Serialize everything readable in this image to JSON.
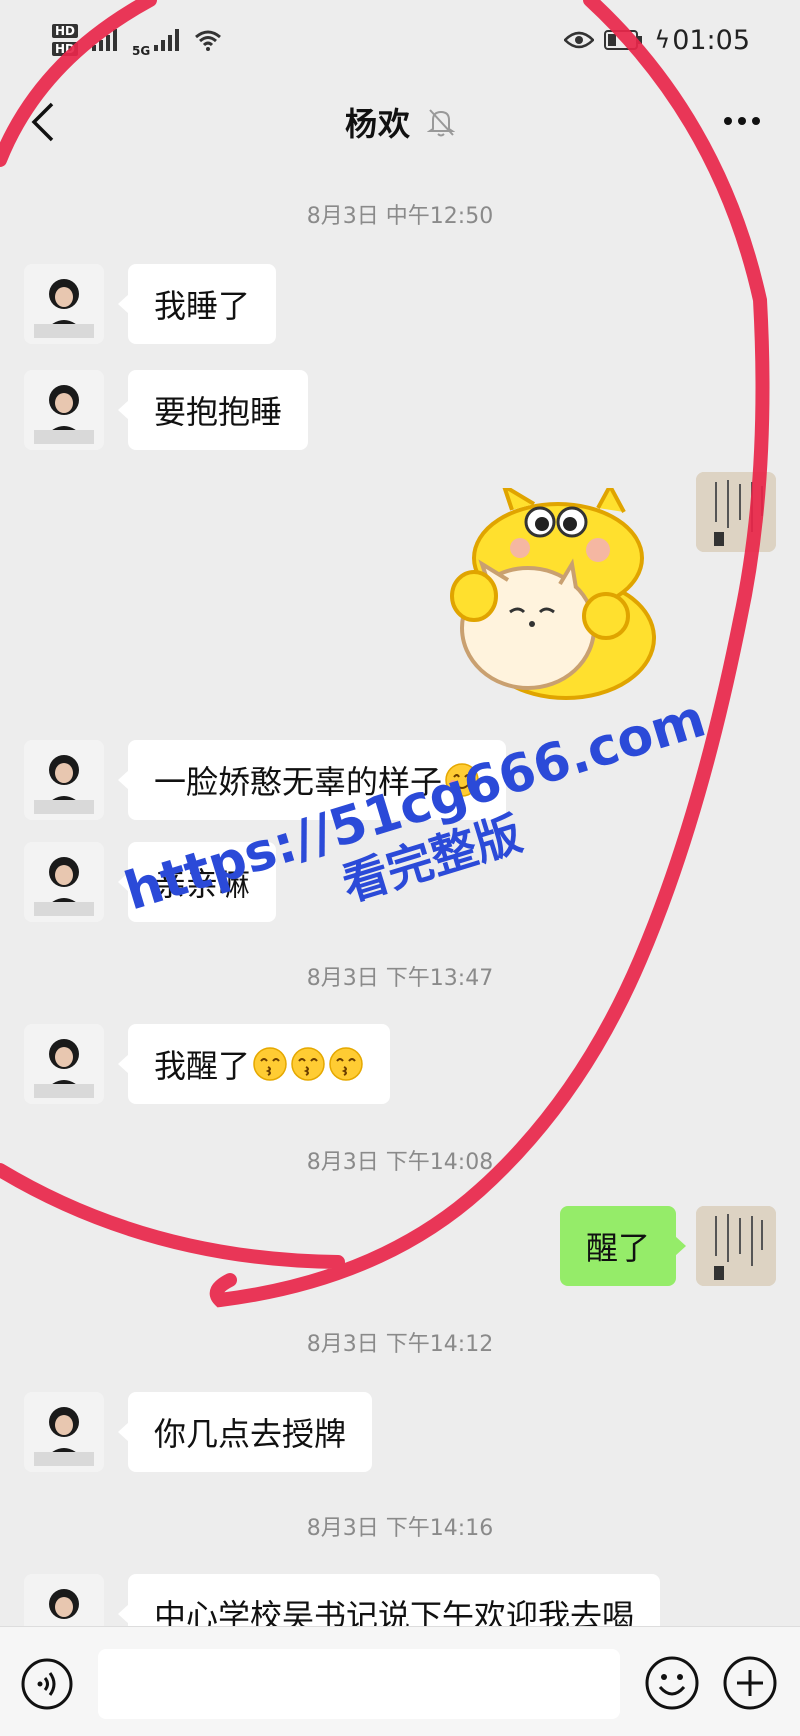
{
  "status_bar": {
    "hd_badge_top": "HD",
    "hd_badge_bottom": "HD",
    "network": "5G",
    "time": "01:05"
  },
  "nav": {
    "title": "杨欢"
  },
  "messages": [
    {
      "type": "timestamp",
      "text": "8月3日 中午12:50"
    },
    {
      "type": "received",
      "text": "我睡了"
    },
    {
      "type": "received",
      "text": "要抱抱睡"
    },
    {
      "type": "sent_sticker",
      "sticker": "yellow-cat-hugging-kitten-sticker"
    },
    {
      "type": "received",
      "text": "一脸娇憨无辜的样子"
    },
    {
      "type": "received",
      "text": "亲亲嘛"
    },
    {
      "type": "timestamp",
      "text": "8月3日 下午13:47"
    },
    {
      "type": "received",
      "text": "我醒了"
    },
    {
      "type": "timestamp",
      "text": "8月3日 下午14:08"
    },
    {
      "type": "sent",
      "text": "醒了"
    },
    {
      "type": "timestamp",
      "text": "8月3日 下午14:12"
    },
    {
      "type": "received",
      "text": "你几点去授牌"
    },
    {
      "type": "timestamp",
      "text": "8月3日 下午14:16"
    },
    {
      "type": "received",
      "text": "中心学校吴书记说下午欢迎我去喝"
    }
  ],
  "watermark": {
    "url": "https://51cg666.com",
    "subtitle": "看完整版"
  },
  "colors": {
    "background": "#ededed",
    "sent_bubble": "#95ec69",
    "received_bubble": "#ffffff",
    "annotation_circle": "#e8264a",
    "watermark": "#2b4ad8"
  }
}
